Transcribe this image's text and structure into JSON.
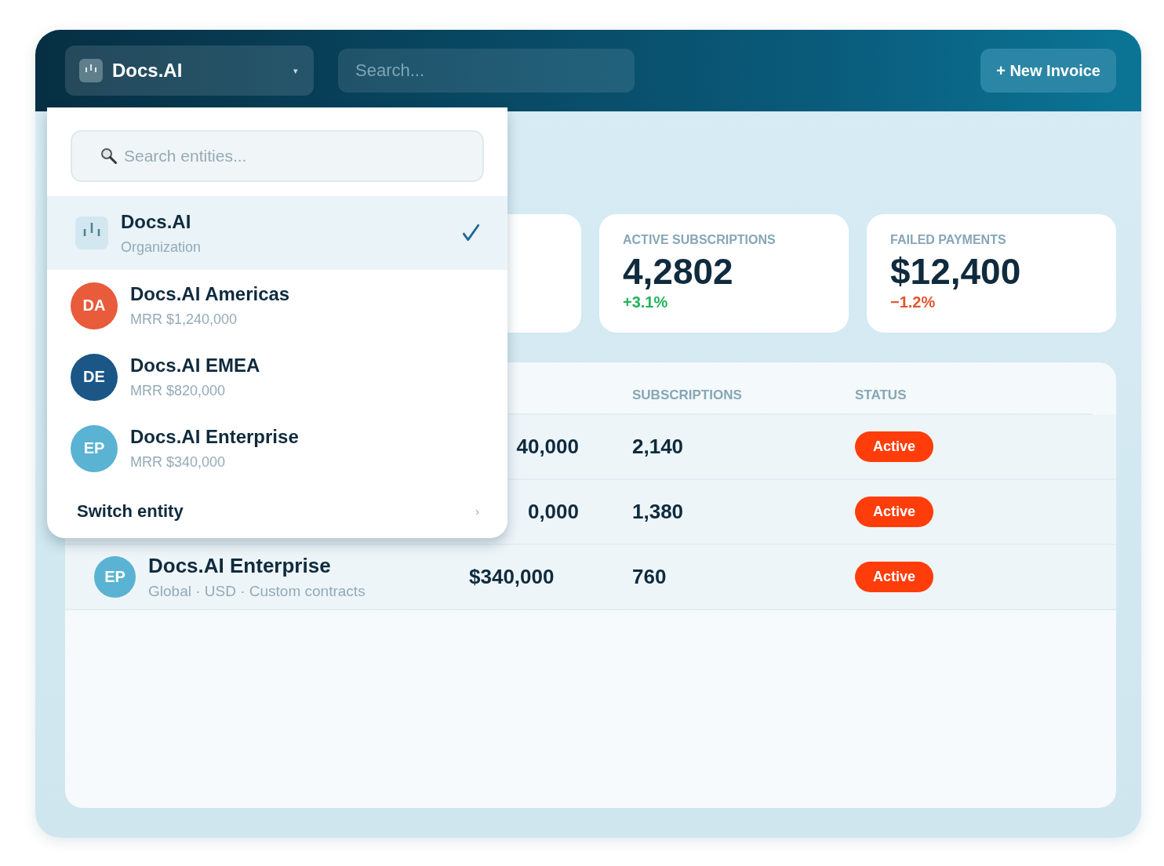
{
  "header": {
    "entity_switcher": {
      "name": "Docs.AI",
      "caret": "▾",
      "expanded": true
    },
    "search": {
      "placeholder": "Search..."
    },
    "new_invoice_button": "+ New Invoice"
  },
  "stat_cards": [
    {
      "label": "ACTIVE SUBSCRIPTIONS",
      "value": "4,2802",
      "change": "+3.1%",
      "color": "#22b45a"
    },
    {
      "label": "FAILED PAYMENTS",
      "value": "$12,400",
      "change": "−1.2%",
      "color": "#e2562f"
    }
  ],
  "table": {
    "columns": [
      {
        "label": "SUBSCRIPTIONS"
      },
      {
        "label": "STATUS"
      }
    ],
    "rows": [
      {
        "amount": "40,000",
        "subscriptions": "2,140",
        "status": "Active"
      },
      {
        "amount": "0,000",
        "subscriptions": "1,380",
        "status": "Active"
      },
      {
        "initials": "EP",
        "color": "#5ab3d3",
        "name": "Docs.AI Enterprise",
        "details": "Global · USD · Custom contracts",
        "amount": "$340,000",
        "subscriptions": "760",
        "status": "Active"
      }
    ]
  },
  "entity_dropdown": {
    "search": {
      "placeholder": "Search entities..."
    },
    "items": [
      {
        "kind": "organization",
        "name": "Docs.AI",
        "subtitle": "Organization",
        "selected": true
      },
      {
        "kind": "entity",
        "initials": "DA",
        "color": "#e85b3b",
        "name": "Docs.AI Americas",
        "subtitle": "MRR $1,240,000",
        "selected": false
      },
      {
        "kind": "entity",
        "initials": "DE",
        "color": "#1b5687",
        "name": "Docs.AI EMEA",
        "subtitle": "MRR $820,000",
        "selected": false
      },
      {
        "kind": "entity",
        "initials": "EP",
        "color": "#5ab3d3",
        "name": "Docs.AI Enterprise",
        "subtitle": "MRR $340,000",
        "selected": false
      }
    ],
    "footer": {
      "label": "Switch entity",
      "chevron": "›"
    }
  }
}
